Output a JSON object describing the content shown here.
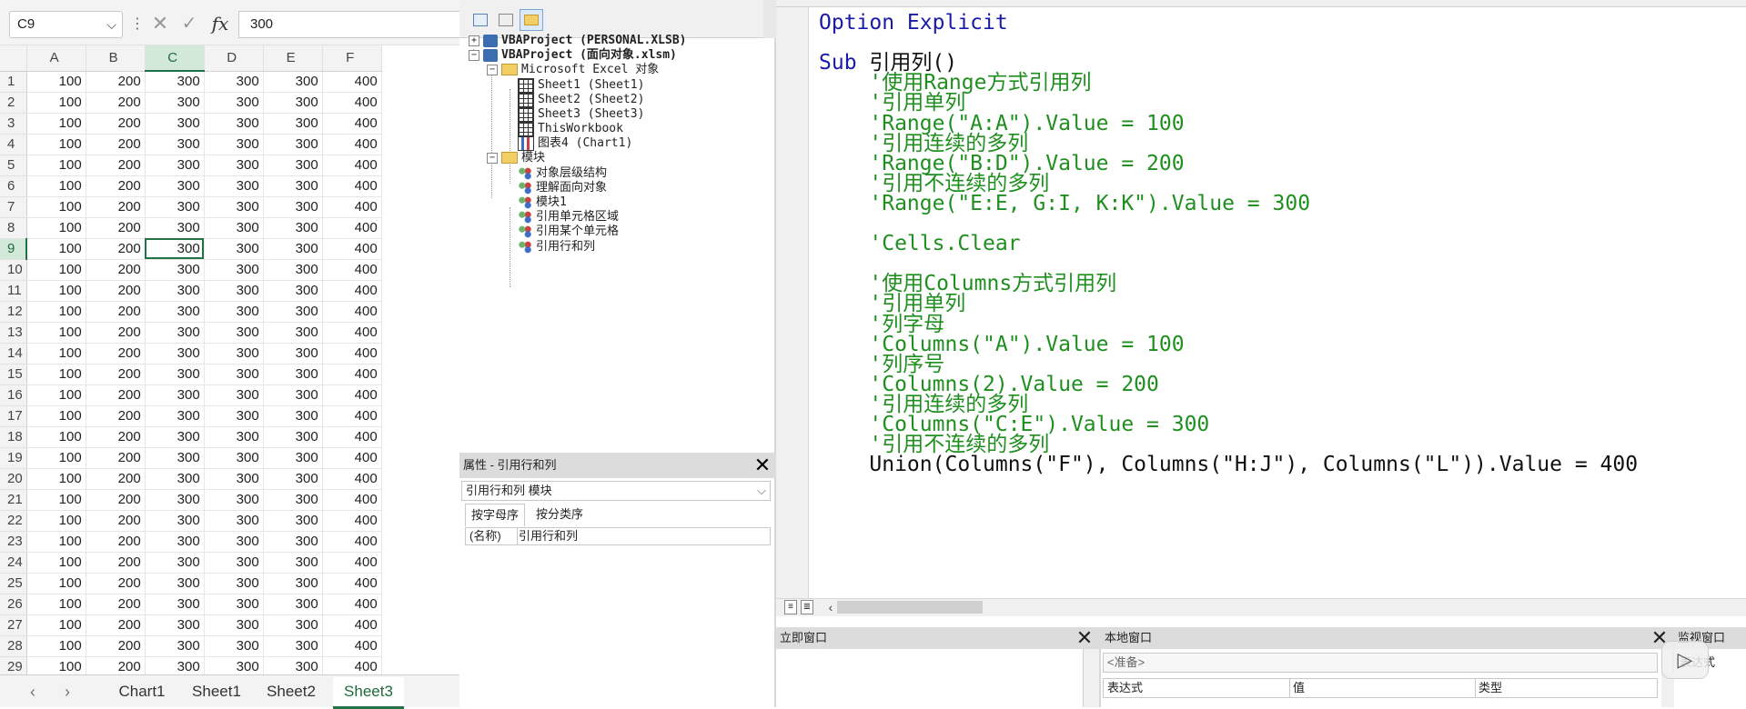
{
  "excel": {
    "name_box": "C9",
    "formula_value": "300",
    "columns": [
      "A",
      "B",
      "C",
      "D",
      "E",
      "F"
    ],
    "selected_column": "C",
    "selected_row": 9,
    "rows": [
      {
        "n": "1",
        "cells": [
          "100",
          "200",
          "300",
          "300",
          "300",
          "400"
        ]
      },
      {
        "n": "2",
        "cells": [
          "100",
          "200",
          "300",
          "300",
          "300",
          "400"
        ]
      },
      {
        "n": "3",
        "cells": [
          "100",
          "200",
          "300",
          "300",
          "300",
          "400"
        ]
      },
      {
        "n": "4",
        "cells": [
          "100",
          "200",
          "300",
          "300",
          "300",
          "400"
        ]
      },
      {
        "n": "5",
        "cells": [
          "100",
          "200",
          "300",
          "300",
          "300",
          "400"
        ]
      },
      {
        "n": "6",
        "cells": [
          "100",
          "200",
          "300",
          "300",
          "300",
          "400"
        ]
      },
      {
        "n": "7",
        "cells": [
          "100",
          "200",
          "300",
          "300",
          "300",
          "400"
        ]
      },
      {
        "n": "8",
        "cells": [
          "100",
          "200",
          "300",
          "300",
          "300",
          "400"
        ]
      },
      {
        "n": "9",
        "cells": [
          "100",
          "200",
          "300",
          "300",
          "300",
          "400"
        ]
      },
      {
        "n": "10",
        "cells": [
          "100",
          "200",
          "300",
          "300",
          "300",
          "400"
        ]
      },
      {
        "n": "11",
        "cells": [
          "100",
          "200",
          "300",
          "300",
          "300",
          "400"
        ]
      },
      {
        "n": "12",
        "cells": [
          "100",
          "200",
          "300",
          "300",
          "300",
          "400"
        ]
      },
      {
        "n": "13",
        "cells": [
          "100",
          "200",
          "300",
          "300",
          "300",
          "400"
        ]
      },
      {
        "n": "14",
        "cells": [
          "100",
          "200",
          "300",
          "300",
          "300",
          "400"
        ]
      },
      {
        "n": "15",
        "cells": [
          "100",
          "200",
          "300",
          "300",
          "300",
          "400"
        ]
      },
      {
        "n": "16",
        "cells": [
          "100",
          "200",
          "300",
          "300",
          "300",
          "400"
        ]
      },
      {
        "n": "17",
        "cells": [
          "100",
          "200",
          "300",
          "300",
          "300",
          "400"
        ]
      },
      {
        "n": "18",
        "cells": [
          "100",
          "200",
          "300",
          "300",
          "300",
          "400"
        ]
      },
      {
        "n": "19",
        "cells": [
          "100",
          "200",
          "300",
          "300",
          "300",
          "400"
        ]
      },
      {
        "n": "20",
        "cells": [
          "100",
          "200",
          "300",
          "300",
          "300",
          "400"
        ]
      },
      {
        "n": "21",
        "cells": [
          "100",
          "200",
          "300",
          "300",
          "300",
          "400"
        ]
      },
      {
        "n": "22",
        "cells": [
          "100",
          "200",
          "300",
          "300",
          "300",
          "400"
        ]
      },
      {
        "n": "23",
        "cells": [
          "100",
          "200",
          "300",
          "300",
          "300",
          "400"
        ]
      },
      {
        "n": "24",
        "cells": [
          "100",
          "200",
          "300",
          "300",
          "300",
          "400"
        ]
      },
      {
        "n": "25",
        "cells": [
          "100",
          "200",
          "300",
          "300",
          "300",
          "400"
        ]
      },
      {
        "n": "26",
        "cells": [
          "100",
          "200",
          "300",
          "300",
          "300",
          "400"
        ]
      },
      {
        "n": "27",
        "cells": [
          "100",
          "200",
          "300",
          "300",
          "300",
          "400"
        ]
      },
      {
        "n": "28",
        "cells": [
          "100",
          "200",
          "300",
          "300",
          "300",
          "400"
        ]
      },
      {
        "n": "29",
        "cells": [
          "100",
          "200",
          "300",
          "300",
          "300",
          "400"
        ]
      }
    ],
    "sheet_tabs": [
      "Chart1",
      "Sheet1",
      "Sheet2",
      "Sheet3"
    ],
    "active_sheet": "Sheet3",
    "accent_color": "#217346"
  },
  "project_explorer": {
    "items": [
      {
        "label": "VBAProject (PERSONAL.XLSB)",
        "icon": "vba-project-icon",
        "bold": true
      },
      {
        "label": "VBAProject (面向对象.xlsm)",
        "icon": "vba-project-icon",
        "bold": true
      },
      {
        "label": "Microsoft Excel 对象",
        "icon": "folder-icon"
      },
      {
        "label": "Sheet1 (Sheet1)",
        "icon": "worksheet-icon"
      },
      {
        "label": "Sheet2 (Sheet2)",
        "icon": "worksheet-icon"
      },
      {
        "label": "Sheet3 (Sheet3)",
        "icon": "worksheet-icon"
      },
      {
        "label": "ThisWorkbook",
        "icon": "workbook-icon"
      },
      {
        "label": "图表4 (Chart1)",
        "icon": "chart-icon"
      },
      {
        "label": "模块",
        "icon": "folder-icon"
      },
      {
        "label": "对象层级结构",
        "icon": "module-icon"
      },
      {
        "label": "理解面向对象",
        "icon": "module-icon"
      },
      {
        "label": "模块1",
        "icon": "module-icon"
      },
      {
        "label": "引用单元格区域",
        "icon": "module-icon"
      },
      {
        "label": "引用某个单元格",
        "icon": "module-icon"
      },
      {
        "label": "引用行和列",
        "icon": "module-icon"
      }
    ]
  },
  "properties": {
    "title": "属性 - 引用行和列",
    "object": "引用行和列 模块",
    "tabs": [
      "按字母序",
      "按分类序"
    ],
    "name_key": "(名称)",
    "name_value": "引用行和列"
  },
  "code": {
    "lines": [
      {
        "type": "kw",
        "text": "Option Explicit"
      },
      {
        "type": "pl",
        "text": ""
      },
      {
        "type": "kw",
        "text": "Sub ",
        "rest": "引用列()"
      },
      {
        "type": "cm",
        "text": "    '使用Range方式引用列"
      },
      {
        "type": "cm",
        "text": "    '引用单列"
      },
      {
        "type": "cm",
        "text": "    'Range(\"A:A\").Value = 100"
      },
      {
        "type": "cm",
        "text": "    '引用连续的多列"
      },
      {
        "type": "cm",
        "text": "    'Range(\"B:D\").Value = 200"
      },
      {
        "type": "cm",
        "text": "    '引用不连续的多列"
      },
      {
        "type": "cm",
        "text": "    'Range(\"E:E, G:I, K:K\").Value = 300"
      },
      {
        "type": "pl",
        "text": ""
      },
      {
        "type": "cm",
        "text": "    'Cells.Clear"
      },
      {
        "type": "pl",
        "text": ""
      },
      {
        "type": "cm",
        "text": "    '使用Columns方式引用列"
      },
      {
        "type": "cm",
        "text": "    '引用单列"
      },
      {
        "type": "cm",
        "text": "    '列字母"
      },
      {
        "type": "cm",
        "text": "    'Columns(\"A\").Value = 100"
      },
      {
        "type": "cm",
        "text": "    '列序号"
      },
      {
        "type": "cm",
        "text": "    'Columns(2).Value = 200"
      },
      {
        "type": "cm",
        "text": "    '引用连续的多列"
      },
      {
        "type": "cm",
        "text": "    'Columns(\"C:E\").Value = 300"
      },
      {
        "type": "cm",
        "text": "    '引用不连续的多列"
      },
      {
        "type": "pl",
        "text": "    Union(Columns(\"F\"), Columns(\"H:J\"), Columns(\"L\")).Value = 400"
      }
    ],
    "keyword_color": "#1a1aa6",
    "comment_color": "#1f8f1f"
  },
  "immediate": {
    "title": "立即窗口"
  },
  "locals": {
    "title": "本地窗口",
    "ready": "<准备>",
    "headers": [
      "表达式",
      "值",
      "类型"
    ]
  },
  "watch": {
    "title": "监视窗口",
    "header": "表达式"
  }
}
